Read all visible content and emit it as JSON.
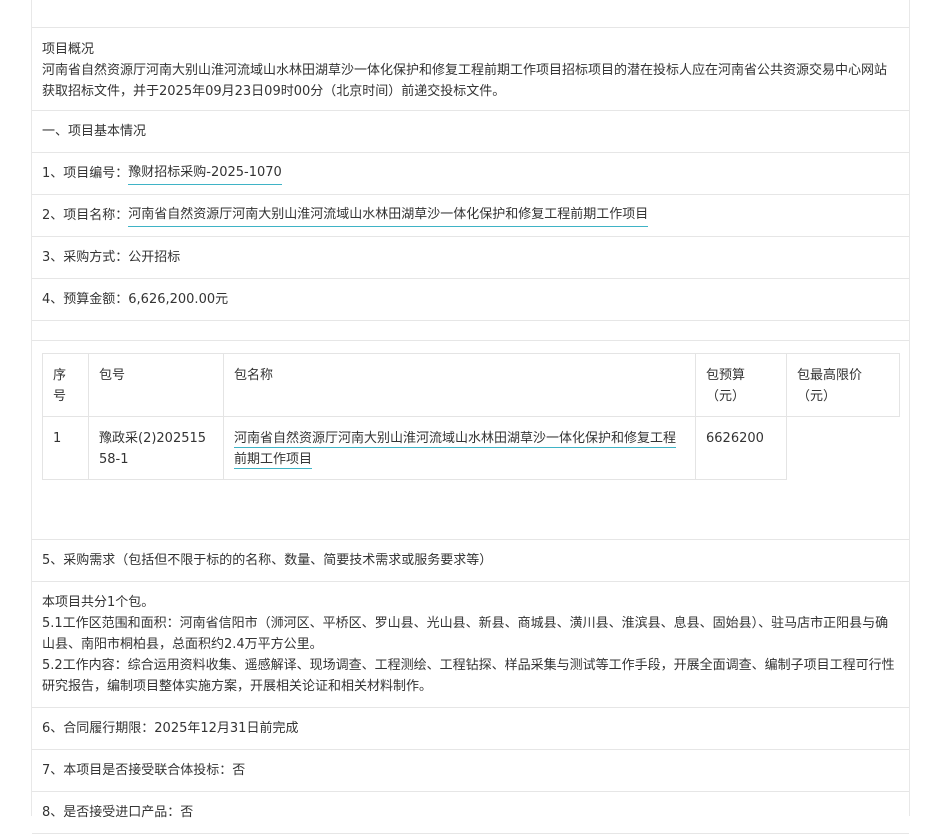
{
  "overview": {
    "heading": "项目概况",
    "text": "河南省自然资源厅河南大别山淮河流域山水林田湖草沙一体化保护和修复工程前期工作项目招标项目的潜在投标人应在河南省公共资源交易中心网站获取招标文件，并于2025年09月23日09时00分（北京时间）前递交投标文件。"
  },
  "section1": {
    "title": "一、项目基本情况",
    "project_no_label": "1、项目编号：",
    "project_no": "豫财招标采购-2025-1070",
    "project_name_label": "2、项目名称：",
    "project_name": "河南省自然资源厅河南大别山淮河流域山水林田湖草沙一体化保护和修复工程前期工作项目",
    "method": "3、采购方式：公开招标",
    "budget": "4、预算金额：6,626,200.00元"
  },
  "table": {
    "headers": {
      "seq": "序号",
      "pkg_no": "包号",
      "pkg_name": "包名称",
      "budget": "包预算（元）",
      "max_price": "包最高限价（元）"
    },
    "rows": [
      {
        "seq": "1",
        "pkg_no": "豫政采(2)20251558-1",
        "pkg_name": "河南省自然资源厅河南大别山淮河流域山水林田湖草沙一体化保护和修复工程前期工作项目",
        "budget": "6626200"
      }
    ]
  },
  "section5": {
    "title": "5、采购需求（包括但不限于标的的名称、数量、简要技术需求或服务要求等）",
    "line1": "本项目共分1个包。",
    "line2": "5.1工作区范围和面积：河南省信阳市（浉河区、平桥区、罗山县、光山县、新县、商城县、潢川县、淮滨县、息县、固始县）、驻马店市正阳县与确山县、南阳市桐柏县，总面积约2.4万平方公里。",
    "line3": "5.2工作内容：综合运用资料收集、遥感解译、现场调查、工程测绘、工程钻探、样品采集与测试等工作手段，开展全面调查、编制子项目工程可行性研究报告，编制项目整体实施方案，开展相关论证和相关材料制作。"
  },
  "section6": "6、合同履行期限：2025年12月31日前完成",
  "section7": "7、本项目是否接受联合体投标：否",
  "section8": "8、是否接受进口产品：否"
}
